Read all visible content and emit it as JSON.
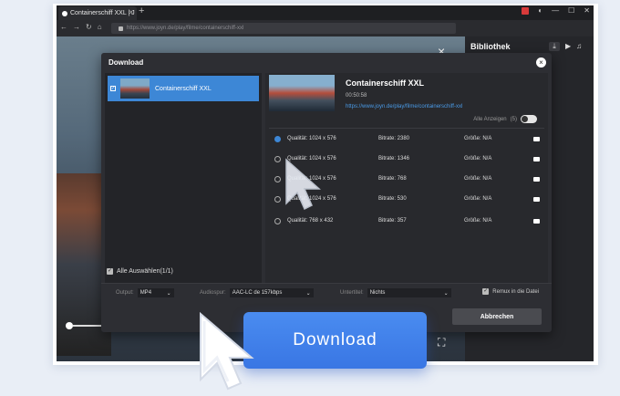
{
  "browser": {
    "tab_title": "Containerschiff XXL | J",
    "url": "https://www.joyn.de/play/filme/containerschiff-xxl"
  },
  "sidebar": {
    "title": "Bibliothek"
  },
  "dialog": {
    "title": "Download",
    "close": "×",
    "item": {
      "label": "Containerschiff XXL",
      "checked": "✓"
    },
    "select_all": "Alle Auswählen(1/1)",
    "detail": {
      "title": "Containerschiff XXL",
      "duration": "00:50:58",
      "url": "https://www.joyn.de/play/filme/containerschiff-xxl",
      "show_all": "Alle Anzeigen",
      "show_all_count": "(5)"
    },
    "qualities": [
      {
        "quality": "Qualität: 1024 x 576",
        "bitrate": "Bitrate: 2380",
        "size": "Größe: N/A",
        "selected": true
      },
      {
        "quality": "Qualität: 1024 x 576",
        "bitrate": "Bitrate: 1346",
        "size": "Größe: N/A",
        "selected": false
      },
      {
        "quality": "Qualität: 1024 x 576",
        "bitrate": "Bitrate: 768",
        "size": "Größe: N/A",
        "selected": false
      },
      {
        "quality": "Qualität: 1024 x 576",
        "bitrate": "Bitrate: 530",
        "size": "Größe: N/A",
        "selected": false
      },
      {
        "quality": "Qualität: 768 x 432",
        "bitrate": "Bitrate: 357",
        "size": "Größe: N/A",
        "selected": false
      }
    ],
    "output_label": "Output:",
    "output_value": "MP4",
    "audio_label": "Audiospur:",
    "audio_value": "AAC-LC de 157kbps",
    "subtitle_label": "Untertitel:",
    "subtitle_value": "Nichts",
    "remux_label": "Remux in die Datei",
    "cancel_label": "Abbrechen"
  },
  "big_button": {
    "label": "Download"
  },
  "colors": {
    "accent": "#3d87d6",
    "big_button": "#3f80ea"
  }
}
